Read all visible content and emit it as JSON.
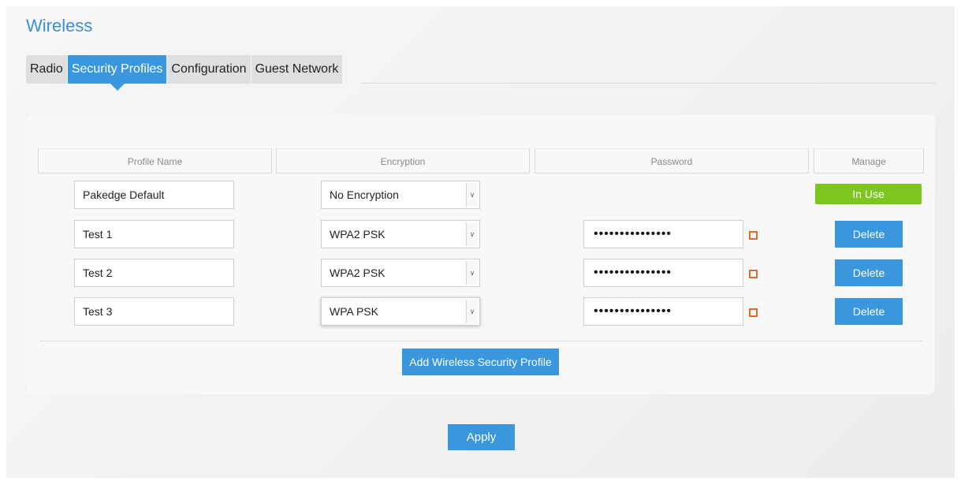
{
  "page": {
    "title": "Wireless"
  },
  "tabs": [
    {
      "label": "Radio",
      "active": false
    },
    {
      "label": "Security Profiles",
      "active": true
    },
    {
      "label": "Configuration",
      "active": false
    },
    {
      "label": "Guest Network",
      "active": false
    }
  ],
  "table": {
    "headers": {
      "profile_name": "Profile Name",
      "encryption": "Encryption",
      "password": "Password",
      "manage": "Manage"
    },
    "rows": [
      {
        "name": "Pakedge Default",
        "encryption": "No Encryption",
        "password": "",
        "manage": "In Use"
      },
      {
        "name": "Test 1",
        "encryption": "WPA2 PSK",
        "password": "•••••••••••••••",
        "manage": "Delete"
      },
      {
        "name": "Test 2",
        "encryption": "WPA2 PSK",
        "password": "•••••••••••••••",
        "manage": "Delete"
      },
      {
        "name": "Test 3",
        "encryption": "WPA PSK",
        "password": "•••••••••••••••",
        "manage": "Delete"
      }
    ]
  },
  "actions": {
    "add_profile": "Add Wireless Security Profile",
    "apply": "Apply"
  },
  "icons": {
    "select_arrow": "chevron-down-icon",
    "password_toggle": "show-password-icon"
  },
  "colors": {
    "accent": "#3a97de",
    "title": "#3c8fd6",
    "in_use": "#7cc61f",
    "password_toggle": "#e26b2c"
  }
}
